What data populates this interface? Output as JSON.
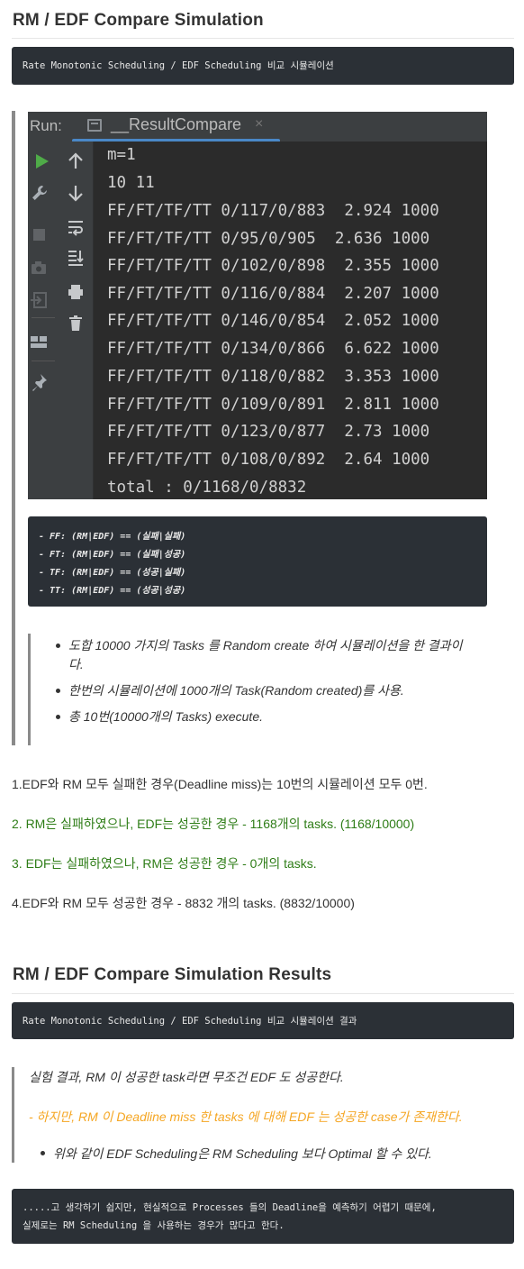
{
  "section1": {
    "title": "RM / EDF Compare Simulation",
    "code": "Rate Monotonic Scheduling / EDF Scheduling 비교 시뮬레이션"
  },
  "ide": {
    "run_label": "Run:",
    "tab_label": "__ResultCompare",
    "close_glyph": "×",
    "output_lines": [
      "m=1",
      "10 11",
      "FF/FT/TF/TT 0/117/0/883  2.924 1000",
      "FF/FT/TF/TT 0/95/0/905  2.636 1000",
      "FF/FT/TF/TT 0/102/0/898  2.355 1000",
      "FF/FT/TF/TT 0/116/0/884  2.207 1000",
      "FF/FT/TF/TT 0/146/0/854  2.052 1000",
      "FF/FT/TF/TT 0/134/0/866  6.622 1000",
      "FF/FT/TF/TT 0/118/0/882  3.353 1000",
      "FF/FT/TF/TT 0/109/0/891  2.811 1000",
      "FF/FT/TF/TT 0/123/0/877  2.73 1000",
      "FF/FT/TF/TT 0/108/0/892  2.64 1000",
      "total : 0/1168/0/8832"
    ],
    "icons": [
      "run-icon",
      "wrench-icon",
      "stop-icon",
      "camera-icon",
      "login-icon",
      "layout-icon",
      "pin-icon",
      "up-arrow-icon",
      "down-arrow-icon",
      "soft-wrap-icon",
      "scroll-to-end-icon",
      "print-icon",
      "trash-icon"
    ]
  },
  "legend": [
    "- FF: (RM|EDF) == (실패|실패)",
    "- FT: (RM|EDF) == (실패|성공)",
    "- TF: (RM|EDF) == (성공|실패)",
    "- TT: (RM|EDF) == (성공|성공)"
  ],
  "bullets": {
    "b1_line1": "도합 10000 가지의 Tasks 를 Random create 하여 시뮬레이션을 한 결과이",
    "b1_line2": "다.",
    "b2": "한번의 시뮬레이션에 1000개의 Task(Random created)를 사용.",
    "b3": "총 10번(10000개의 Tasks) execute."
  },
  "results": {
    "r1": "1.EDF와 RM 모두 실패한 경우(Deadline miss)는 10번의 시뮬레이션 모두 0번.",
    "r2": "2. RM은 실패하였으나, EDF는 성공한 경우 - 1168개의 tasks. (1168/10000)",
    "r3": "3. EDF는 실패하였으나, RM은 성공한 경우 - 0개의 tasks.",
    "r4": "4.EDF와 RM 모두 성공한 경우 - 8832 개의 tasks. (8832/10000)"
  },
  "section2": {
    "title": "RM / EDF Compare Simulation Results",
    "code": "Rate Monotonic Scheduling / EDF Scheduling 비교 시뮬레이션 결과",
    "quote_line1": "실험 결과, RM 이 성공한 task라면 무조건 EDF 도 성공한다.",
    "quote_line2": "- 하지만, RM 이 Deadline miss 한 tasks 에 대해 EDF 는 성공한 case가 존재한다.",
    "quote_bullet": "위와 같이 EDF Scheduling은 RM Scheduling 보다 Optimal 할 수 있다.",
    "final_code_line1": ".....고 생각하기 쉽지만, 현실적으로 Processes 들의 Deadline을 예측하기 어렵기 때문에,",
    "final_code_line2": "실제로는 RM Scheduling 을 사용하는 경우가 많다고 한다."
  },
  "colors": {
    "green": "#2e7d17",
    "orange": "#f5a623",
    "code_bg": "#2b3036",
    "ide_bg": "#2b2b2b",
    "ide_panel": "#3c3f41",
    "run_green": "#4fab48",
    "tab_underline": "#4a88c7"
  }
}
